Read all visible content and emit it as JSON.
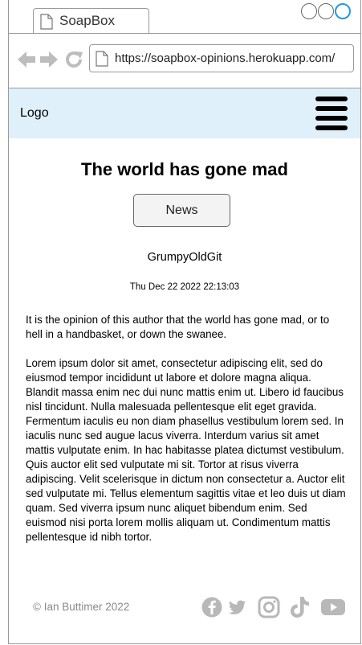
{
  "browser": {
    "tab_title": "SoapBox",
    "url": "https://soapbox-opinions.herokuapp.com/"
  },
  "header": {
    "logo": "Logo"
  },
  "post": {
    "title": "The world has gone mad",
    "category": "News",
    "author": "GrumpyOldGit",
    "date": "Thu Dec 22 2022 22:13:03",
    "intro": "It is the opinion of this author that the world has gone mad, or to hell in a handbasket, or down the swanee.",
    "body": "Lorem ipsum dolor sit amet, consectetur adipiscing elit, sed do eiusmod tempor incididunt ut labore et dolore magna aliqua. Blandit massa enim nec dui nunc mattis enim ut. Libero id faucibus nisl tincidunt. Nulla malesuada pellentesque elit eget gravida. Fermentum iaculis eu non diam phasellus vestibulum lorem sed. In iaculis nunc sed augue lacus viverra. Interdum varius sit amet mattis vulputate enim. In hac habitasse platea dictumst vestibulum. Quis auctor elit sed vulputate mi sit. Tortor at risus viverra adipiscing. Velit scelerisque in dictum non consectetur a. Auctor elit sed vulputate mi. Tellus elementum sagittis vitae et leo duis ut diam quam. Sed viverra ipsum nunc aliquet bibendum enim. Sed euismod nisi porta lorem mollis aliquam ut. Condimentum mattis pellentesque id nibh tortor."
  },
  "footer": {
    "copyright": "© Ian Buttimer 2022",
    "social_icons": [
      "facebook-icon",
      "twitter-icon",
      "instagram-icon",
      "tiktok-icon",
      "youtube-icon"
    ]
  },
  "colors": {
    "header_bg": "#dff0fb",
    "icon_gray": "#b8b8b8",
    "maximize_accent": "#1e9be0"
  }
}
